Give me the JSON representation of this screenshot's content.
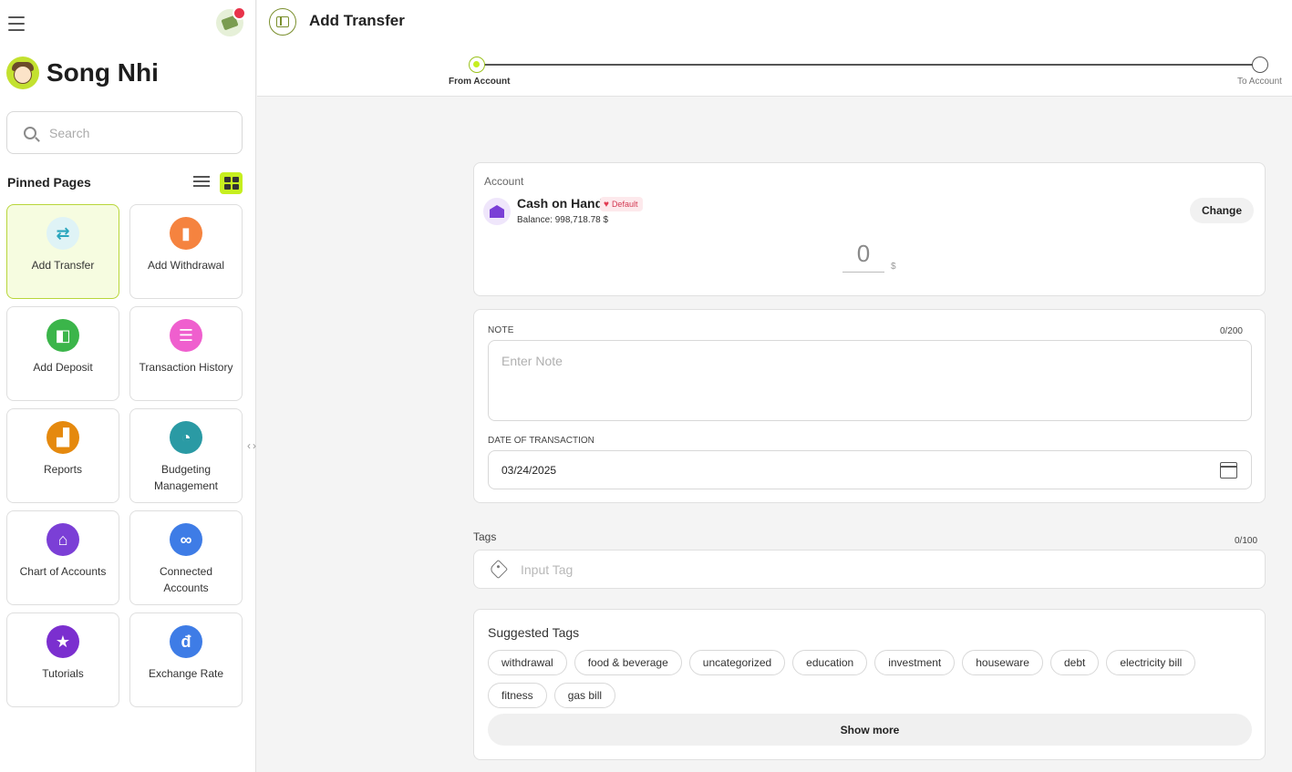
{
  "sidebar": {
    "username": "Song Nhi",
    "search_placeholder": "Search",
    "pinned_heading": "Pinned Pages",
    "tiles": [
      {
        "label": "Add Transfer",
        "icon": "transfer-icon",
        "color": "#dff3f6",
        "glyph": "⇄",
        "glyph_color": "#2aa6bd",
        "active": true
      },
      {
        "label": "Add Withdrawal",
        "icon": "withdrawal-icon",
        "color": "#f5833f",
        "glyph": "▮"
      },
      {
        "label": "Add Deposit",
        "icon": "wallet-icon",
        "color": "#3bb54a",
        "glyph": "◧"
      },
      {
        "label": "Transaction History",
        "icon": "history-icon",
        "color": "#ef5fce",
        "glyph": "☰"
      },
      {
        "label": "Reports",
        "icon": "reports-icon",
        "color": "#e5890e",
        "glyph": "▟"
      },
      {
        "label": "Budgeting Management",
        "icon": "budget-icon",
        "color": "#2a9aa4",
        "glyph": "◔"
      },
      {
        "label": "Chart of Accounts",
        "icon": "bank-icon",
        "color": "#7b3fd6",
        "glyph": "⌂"
      },
      {
        "label": "Connected Accounts",
        "icon": "link-icon",
        "color": "#3e7ce6",
        "glyph": "∞"
      },
      {
        "label": "Tutorials",
        "icon": "star-icon",
        "color": "#7b2fcf",
        "glyph": "★"
      },
      {
        "label": "Exchange Rate",
        "icon": "currency-icon",
        "color": "#3e7ce6",
        "glyph": "đ"
      }
    ]
  },
  "header": {
    "title": "Add Transfer",
    "steps": [
      "From Account",
      "To Account"
    ]
  },
  "account": {
    "label": "Account",
    "name": "Cash on Hand",
    "badge": "Default",
    "balance": "Balance: 998,718.78 $",
    "change_label": "Change",
    "amount": "0",
    "currency": "$"
  },
  "note": {
    "label": "NOTE",
    "count": "0/200",
    "placeholder": "Enter Note",
    "date_label": "DATE OF TRANSACTION",
    "date_value": "03/24/2025"
  },
  "tags": {
    "label": "Tags",
    "count": "0/100",
    "placeholder": "Input Tag",
    "suggested_title": "Suggested Tags",
    "suggested": [
      "withdrawal",
      "food & beverage",
      "uncategorized",
      "education",
      "investment",
      "houseware",
      "debt",
      "electricity bill",
      "fitness",
      "gas bill"
    ],
    "show_more": "Show more"
  }
}
